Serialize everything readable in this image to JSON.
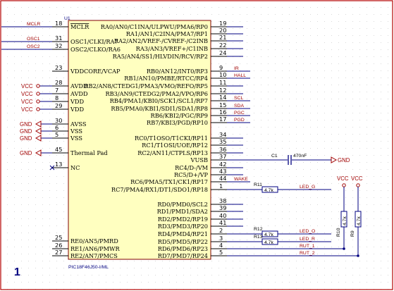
{
  "ic": {
    "designator": "U1",
    "part_number": "PIC18F46J50-I/ML"
  },
  "sheet": {
    "number": "1"
  },
  "left_pins": [
    {
      "num": "18",
      "name": "MCLR",
      "overline": true,
      "net": "MCLR"
    },
    {
      "num": "31",
      "name": "OSC1/CLKI/RA7",
      "net": "OSC1"
    },
    {
      "num": "32",
      "name": "OSC2/CLKO/RA6",
      "net": "OSC2"
    },
    {
      "num": "23",
      "name": "VDDCORE/VCAP"
    },
    {
      "num": "28",
      "name": "AVDD",
      "net": "VCC"
    },
    {
      "num": "7",
      "name": "AVDD",
      "net": "VCC"
    },
    {
      "num": "8",
      "name": "VDD",
      "net": "VCC"
    },
    {
      "num": "29",
      "name": "VDD",
      "net": "VCC"
    },
    {
      "num": "30",
      "name": "AVSS",
      "net": "GND"
    },
    {
      "num": "6",
      "name": "VSS",
      "net": "GND"
    },
    {
      "num": "5",
      "name": "VSS",
      "net": "GND"
    },
    {
      "num": "45",
      "name": "Thermal Pad",
      "net": "GND"
    },
    {
      "num": "13",
      "name": "NC",
      "nc": true
    },
    {
      "num": "25",
      "name": "RE0/AN5/PMRD"
    },
    {
      "num": "26",
      "name": "RE1/AN6/PMWR"
    },
    {
      "num": "27",
      "name": "RE2/AN7/PMCS"
    }
  ],
  "right_pins": [
    {
      "num": "19",
      "name": "RA0/AN0/C1INA/ULPWU/PMA6/RP0"
    },
    {
      "num": "20",
      "name": "RA1/AN1/C2INA/PMA7/RP1"
    },
    {
      "num": "21",
      "name": "RA2/AN2/VREF-/CVREF-/C2INB"
    },
    {
      "num": "22",
      "name": "RA3/AN3/VREF+/C1INB"
    },
    {
      "num": "24",
      "name": "RA5/AN4/SS1/HLVDIN/RCV/RP2"
    },
    {
      "num": "9",
      "name": "RB0/AN12/INT0/RP3",
      "net": "IR"
    },
    {
      "num": "10",
      "name": "RB1/AN10/PMBE/RTCC/RP4",
      "net": "HALL"
    },
    {
      "num": "11",
      "name": "RB2/AN8/CTEDG1/PMA3/VMO/REFO/RP5"
    },
    {
      "num": "12",
      "name": "RB3/AN9/CTEDG2/PMA2/VPO/RP6"
    },
    {
      "num": "14",
      "name": "RB4/PMA1/KBI0/SCK1/SCL1/RP7",
      "net": "SCL"
    },
    {
      "num": "15",
      "name": "RB5/PMA0/KBI1/SDI1/SDA1/RP8",
      "net": "SDA"
    },
    {
      "num": "16",
      "name": "RB6/KBI2/PGC/RP9",
      "net": "PGC"
    },
    {
      "num": "17",
      "name": "RB7/KBI3/PGD/RP10",
      "net": "PGD"
    },
    {
      "num": "34",
      "name": "RC0/T1OSO/T1CKI/RP11"
    },
    {
      "num": "35",
      "name": "RC1/T1OSI/UOE/RP12"
    },
    {
      "num": "36",
      "name": "RC2/AN11/CTPLS/RP13"
    },
    {
      "num": "37",
      "name": "VUSB"
    },
    {
      "num": "42",
      "name": "RC4/D-/VM"
    },
    {
      "num": "43",
      "name": "RC5/D+/VP"
    },
    {
      "num": "44",
      "name": "RC6/PMA5/TX1/CK1/RP17",
      "net": "WAKE"
    },
    {
      "num": "1",
      "name": "RC7/PMA4/RX1/DT1/SDO1/RP18"
    },
    {
      "num": "38",
      "name": "RD0/PMD0/SCL2"
    },
    {
      "num": "39",
      "name": "RD1/PMD1/SDA2"
    },
    {
      "num": "40",
      "name": "RD2/PMD2/RP19"
    },
    {
      "num": "41",
      "name": "RD3/PMD3/RP20"
    },
    {
      "num": "2",
      "name": "RD4/PMD4/RP21"
    },
    {
      "num": "3",
      "name": "RD5/PMD5/RP22"
    },
    {
      "num": "4",
      "name": "RD6/PMD6/RP23"
    },
    {
      "num": "5",
      "name": "RD7/PMD7/RP24"
    }
  ],
  "components": {
    "capacitor": {
      "ref": "C1",
      "value": "470nF",
      "net": "GND"
    },
    "resistors": [
      {
        "ref": "R11",
        "value": "4.7k",
        "net": "LED_G"
      },
      {
        "ref": "R12",
        "value": "4.7k",
        "net": "LED_O"
      },
      {
        "ref": "R13",
        "value": "4.7k",
        "net": "LED_R"
      },
      {
        "ref": "R10",
        "value": "4.7k",
        "net": "RUT_1",
        "supply": "VCC"
      },
      {
        "ref": "R9",
        "value": "4.7k",
        "net": "RUT_2",
        "supply": "VCC"
      }
    ]
  },
  "colors": {
    "wire": "#000080",
    "pin": "#000000",
    "net_label": "#a00000",
    "body": "#ffffc0",
    "border": "#b40000"
  }
}
